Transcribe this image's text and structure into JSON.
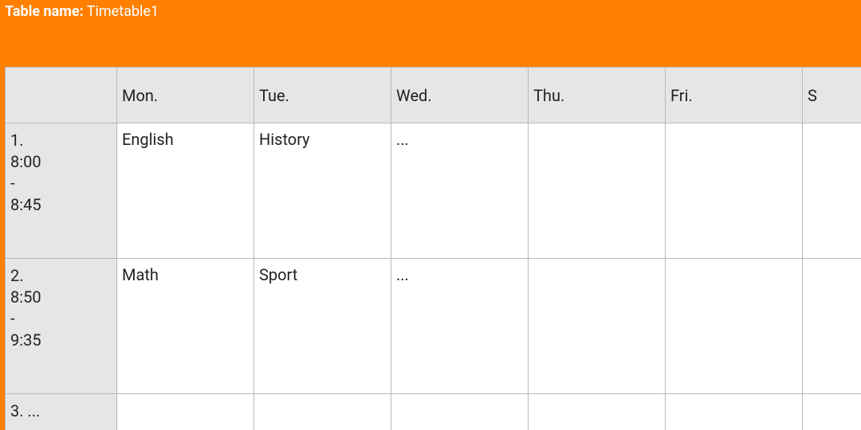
{
  "header": {
    "label": "Table name:",
    "value": "Timetable1"
  },
  "columns": [
    "",
    "Mon.",
    "Tue.",
    "Wed.",
    "Thu.",
    "Fri.",
    "S"
  ],
  "rows": [
    {
      "time": "1.\n8:00\n-\n8:45",
      "cells": [
        "English",
        "History",
        "...",
        "",
        "",
        ""
      ]
    },
    {
      "time": "2.\n8:50\n-\n9:35",
      "cells": [
        "Math",
        "Sport",
        "...",
        "",
        "",
        ""
      ]
    },
    {
      "time": "3. ...",
      "cells": [
        "",
        "",
        "",
        "",
        "",
        ""
      ]
    }
  ]
}
